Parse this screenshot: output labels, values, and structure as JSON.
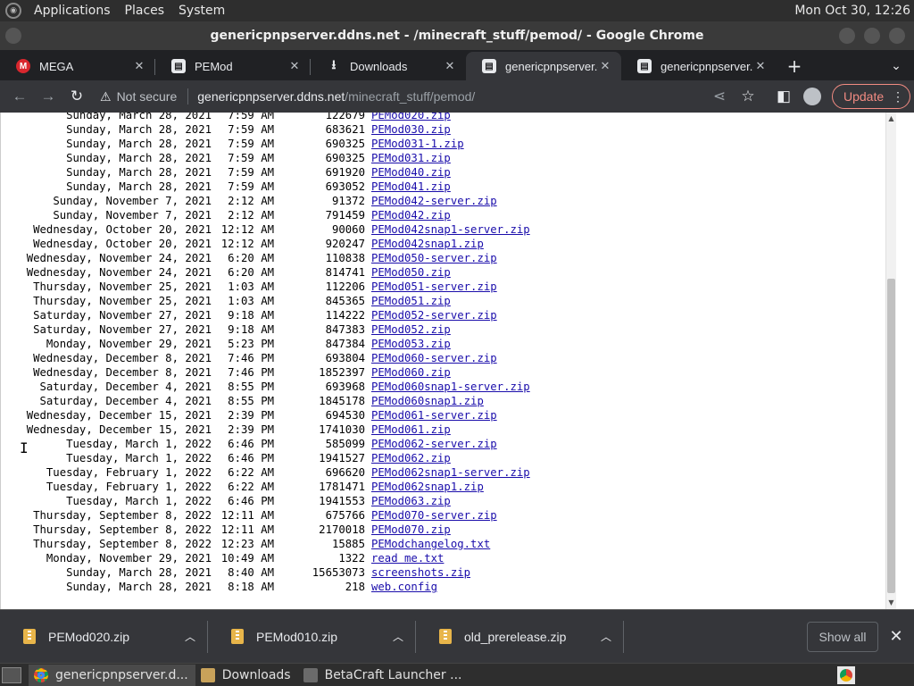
{
  "top_panel": {
    "menus": [
      "Applications",
      "Places",
      "System"
    ],
    "clock": "Mon Oct 30, 12:26"
  },
  "window": {
    "title": "genericpnpserver.ddns.net - /minecraft_stuff/pemod/ - Google Chrome"
  },
  "tabs": [
    {
      "title": "MEGA",
      "icon": "mega-icon",
      "active": false
    },
    {
      "title": "PEMod",
      "icon": "document-icon",
      "active": false
    },
    {
      "title": "Downloads",
      "icon": "download-icon",
      "active": false
    },
    {
      "title": "genericpnpserver.d",
      "icon": "document-icon",
      "active": true
    },
    {
      "title": "genericpnpserver.d",
      "icon": "document-icon",
      "active": false
    }
  ],
  "toolbar": {
    "security_label": "Not secure",
    "url_host": "genericpnpserver.ddns.net",
    "url_path": "/minecraft_stuff/pemod/",
    "update_label": "Update"
  },
  "listing": [
    {
      "date": "Sunday, March 28, 2021",
      "time": "7:59 AM",
      "size": "122679",
      "name": "PEMod020.zip"
    },
    {
      "date": "Sunday, March 28, 2021",
      "time": "7:59 AM",
      "size": "683621",
      "name": "PEMod030.zip"
    },
    {
      "date": "Sunday, March 28, 2021",
      "time": "7:59 AM",
      "size": "690325",
      "name": "PEMod031-1.zip"
    },
    {
      "date": "Sunday, March 28, 2021",
      "time": "7:59 AM",
      "size": "690325",
      "name": "PEMod031.zip"
    },
    {
      "date": "Sunday, March 28, 2021",
      "time": "7:59 AM",
      "size": "691920",
      "name": "PEMod040.zip"
    },
    {
      "date": "Sunday, March 28, 2021",
      "time": "7:59 AM",
      "size": "693052",
      "name": "PEMod041.zip"
    },
    {
      "date": "Sunday, November 7, 2021",
      "time": "2:12 AM",
      "size": "91372",
      "name": "PEMod042-server.zip"
    },
    {
      "date": "Sunday, November 7, 2021",
      "time": "2:12 AM",
      "size": "791459",
      "name": "PEMod042.zip"
    },
    {
      "date": "Wednesday, October 20, 2021",
      "time": "12:12 AM",
      "size": "90060",
      "name": "PEMod042snap1-server.zip"
    },
    {
      "date": "Wednesday, October 20, 2021",
      "time": "12:12 AM",
      "size": "920247",
      "name": "PEMod042snap1.zip"
    },
    {
      "date": "Wednesday, November 24, 2021",
      "time": "6:20 AM",
      "size": "110838",
      "name": "PEMod050-server.zip"
    },
    {
      "date": "Wednesday, November 24, 2021",
      "time": "6:20 AM",
      "size": "814741",
      "name": "PEMod050.zip"
    },
    {
      "date": "Thursday, November 25, 2021",
      "time": "1:03 AM",
      "size": "112206",
      "name": "PEMod051-server.zip"
    },
    {
      "date": "Thursday, November 25, 2021",
      "time": "1:03 AM",
      "size": "845365",
      "name": "PEMod051.zip"
    },
    {
      "date": "Saturday, November 27, 2021",
      "time": "9:18 AM",
      "size": "114222",
      "name": "PEMod052-server.zip"
    },
    {
      "date": "Saturday, November 27, 2021",
      "time": "9:18 AM",
      "size": "847383",
      "name": "PEMod052.zip"
    },
    {
      "date": "Monday, November 29, 2021",
      "time": "5:23 PM",
      "size": "847384",
      "name": "PEMod053.zip"
    },
    {
      "date": "Wednesday, December 8, 2021",
      "time": "7:46 PM",
      "size": "693804",
      "name": "PEMod060-server.zip"
    },
    {
      "date": "Wednesday, December 8, 2021",
      "time": "7:46 PM",
      "size": "1852397",
      "name": "PEMod060.zip"
    },
    {
      "date": "Saturday, December 4, 2021",
      "time": "8:55 PM",
      "size": "693968",
      "name": "PEMod060snap1-server.zip"
    },
    {
      "date": "Saturday, December 4, 2021",
      "time": "8:55 PM",
      "size": "1845178",
      "name": "PEMod060snap1.zip"
    },
    {
      "date": "Wednesday, December 15, 2021",
      "time": "2:39 PM",
      "size": "694530",
      "name": "PEMod061-server.zip"
    },
    {
      "date": "Wednesday, December 15, 2021",
      "time": "2:39 PM",
      "size": "1741030",
      "name": "PEMod061.zip"
    },
    {
      "date": "Tuesday, March 1, 2022",
      "time": "6:46 PM",
      "size": "585099",
      "name": "PEMod062-server.zip"
    },
    {
      "date": "Tuesday, March 1, 2022",
      "time": "6:46 PM",
      "size": "1941527",
      "name": "PEMod062.zip"
    },
    {
      "date": "Tuesday, February 1, 2022",
      "time": "6:22 AM",
      "size": "696620",
      "name": "PEMod062snap1-server.zip"
    },
    {
      "date": "Tuesday, February 1, 2022",
      "time": "6:22 AM",
      "size": "1781471",
      "name": "PEMod062snap1.zip"
    },
    {
      "date": "Tuesday, March 1, 2022",
      "time": "6:46 PM",
      "size": "1941553",
      "name": "PEMod063.zip"
    },
    {
      "date": "Thursday, September 8, 2022",
      "time": "12:11 AM",
      "size": "675766",
      "name": "PEMod070-server.zip"
    },
    {
      "date": "Thursday, September 8, 2022",
      "time": "12:11 AM",
      "size": "2170018",
      "name": "PEMod070.zip"
    },
    {
      "date": "Thursday, September 8, 2022",
      "time": "12:23 AM",
      "size": "15885",
      "name": "PEModchangelog.txt"
    },
    {
      "date": "Monday, November 29, 2021",
      "time": "10:49 AM",
      "size": "1322",
      "name": "read me.txt"
    },
    {
      "date": "Sunday, March 28, 2021",
      "time": "8:40 AM",
      "size": "15653073",
      "name": "screenshots.zip"
    },
    {
      "date": "Sunday, March 28, 2021",
      "time": "8:18 AM",
      "size": "218",
      "name": "web.config"
    }
  ],
  "downloads_shelf": {
    "items": [
      "PEMod020.zip",
      "PEMod010.zip",
      "old_prerelease.zip"
    ],
    "show_all_label": "Show all"
  },
  "taskbar": {
    "tasks": [
      {
        "label": "genericpnpserver.d...",
        "icon": "chrome-icon",
        "active": true
      },
      {
        "label": "Downloads",
        "icon": "folder-icon",
        "active": false
      },
      {
        "label": "BetaCraft Launcher ...",
        "icon": "java-icon",
        "active": false
      }
    ]
  },
  "colors": {
    "link": "#1a0dab",
    "tab_active": "#35363a",
    "tabstrip": "#202124",
    "update_accent": "#f28b82"
  }
}
